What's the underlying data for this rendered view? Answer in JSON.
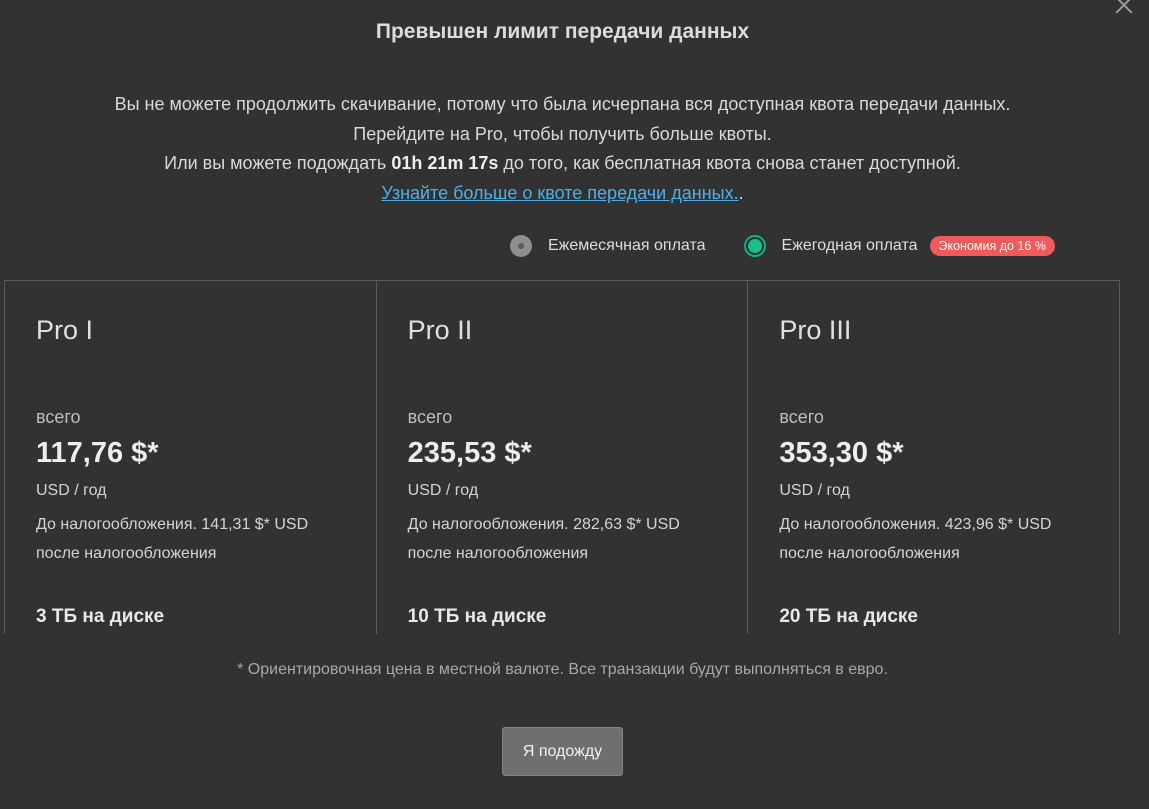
{
  "dialog": {
    "title": "Превышен лимит передачи данных",
    "description": {
      "line1": "Вы не можете продолжить скачивание, потому что была исчерпана вся доступная квота передачи данных.",
      "line2": "Перейдите на Pro, чтобы получить больше квоты.",
      "line3_prefix": "Или вы можете подождать ",
      "countdown": "01h 21m 17s",
      "line3_suffix": " до того, как бесплатная квота снова станет доступной.",
      "learn_more_link": "Узнайте больше о квоте передачи данных.",
      "learn_more_suffix": "."
    },
    "close_icon": "close-icon"
  },
  "billing": {
    "monthly_label": "Ежемесячная оплата",
    "yearly_label": "Ежегодная оплата",
    "selected": "yearly",
    "savings_badge": "Экономия до 16 %",
    "accent_color": "#14c08f",
    "badge_color": "#f05a5a"
  },
  "plans": [
    {
      "name": "Pro I",
      "total_label": "всего",
      "price": "117,76 $*",
      "period": "USD / год",
      "tax_note": "До налогообложения. 141,31 $* USD после налогообложения",
      "storage": "3 ТБ на диске"
    },
    {
      "name": "Pro II",
      "total_label": "всего",
      "price": "235,53 $*",
      "period": "USD / год",
      "tax_note": "До налогообложения. 282,63 $* USD после налогообложения",
      "storage": "10 ТБ на диске"
    },
    {
      "name": "Pro III",
      "total_label": "всего",
      "price": "353,30 $*",
      "period": "USD / год",
      "tax_note": "До налогообложения. 423,96 $* USD после налогообложения",
      "storage": "20 ТБ на диске"
    }
  ],
  "footnote": "* Ориентировочная цена в местной валюте. Все транзакции будут выполняться в евро.",
  "wait_button": "Я подожду"
}
